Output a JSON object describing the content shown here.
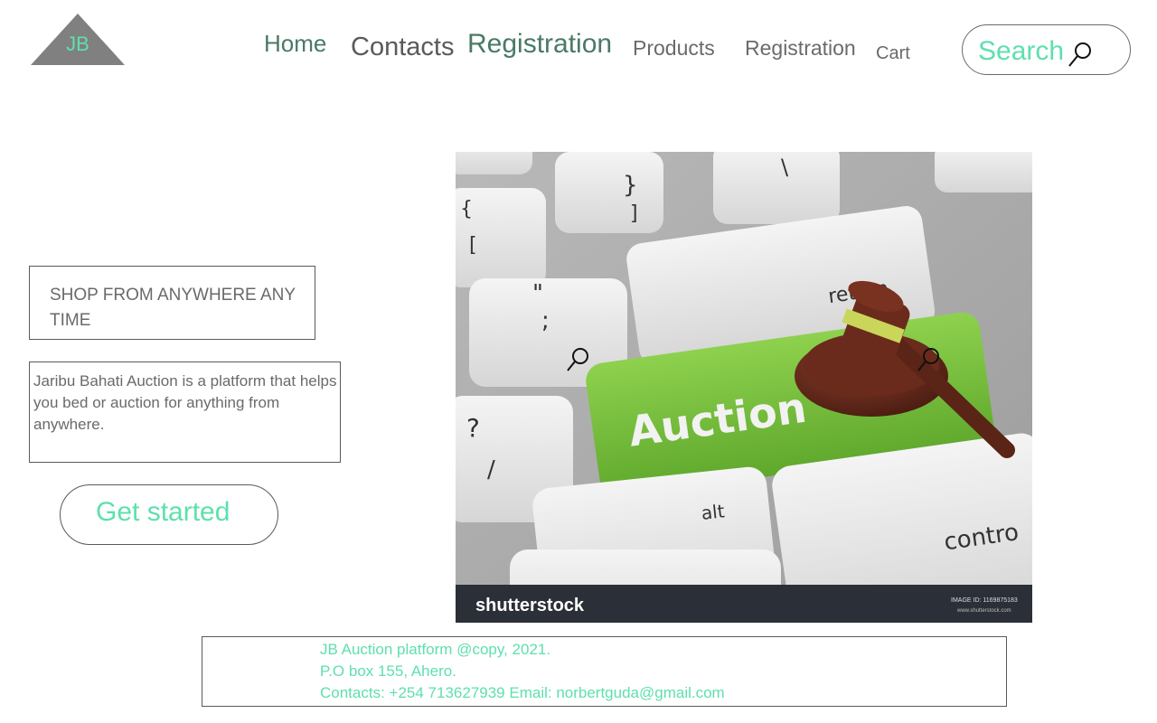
{
  "logo": {
    "text": "JB"
  },
  "nav": {
    "home": "Home",
    "contacts": "Contacts",
    "registration_primary": "Registration",
    "products": "Products",
    "registration_secondary": "Registration",
    "cart": "Cart"
  },
  "search": {
    "label": "Search"
  },
  "hero": {
    "tagline": "SHOP FROM ANYWHERE ANY TIME",
    "description": "Jaribu Bahati Auction is a platform that helps you bed or auction for anything from anywhere.",
    "cta_label": "Get started"
  },
  "hero_image": {
    "key_label": "Auction",
    "return_label": "return",
    "alt_label": "alt",
    "control_label": "contro",
    "watermark": "shutterstock",
    "image_id": "IMAGE ID: 1169875183",
    "watermark_url": "www.shutterstock.com"
  },
  "footer": {
    "copyright": "JB Auction platform @copy, 2021.",
    "address": "P.O box 155, Ahero.",
    "contacts": "Contacts: +254 713627939 Email: norbertguda@gmail.com"
  },
  "colors": {
    "accent": "#5ee0ad",
    "nav_green": "#4a7a66",
    "text_gray": "#6a6a6a",
    "logo_gray": "#808080",
    "key_green": "#7ac943"
  }
}
